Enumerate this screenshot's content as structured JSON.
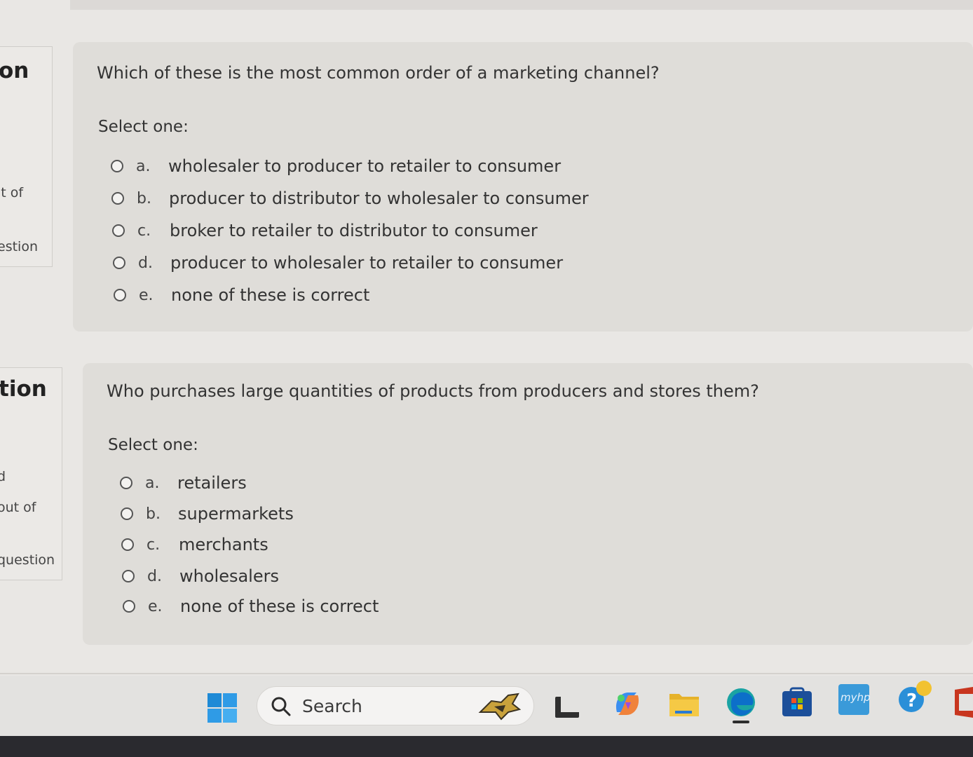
{
  "sidebar_cards": [
    {
      "heading": "on",
      "lines": [
        "it of",
        "estion"
      ]
    },
    {
      "heading": "tion",
      "lines": [
        "d",
        "out of",
        "question"
      ]
    }
  ],
  "questions": [
    {
      "text": "Which of these is the most common order of a marketing channel?",
      "select_label": "Select one:",
      "options": [
        {
          "letter": "a.",
          "text": "wholesaler to producer to retailer to consumer"
        },
        {
          "letter": "b.",
          "text": "producer to distributor to wholesaler to consumer"
        },
        {
          "letter": "c.",
          "text": "broker to retailer to distributor to consumer"
        },
        {
          "letter": "d.",
          "text": "producer to wholesaler to retailer to consumer"
        },
        {
          "letter": "e.",
          "text": "none of these is correct"
        }
      ]
    },
    {
      "text": "Who purchases large quantities of products from producers and stores them?",
      "select_label": "Select one:",
      "options": [
        {
          "letter": "a.",
          "text": "retailers"
        },
        {
          "letter": "b.",
          "text": "supermarkets"
        },
        {
          "letter": "c.",
          "text": "merchants"
        },
        {
          "letter": "d.",
          "text": "wholesalers"
        },
        {
          "letter": "e.",
          "text": "none of these is correct"
        }
      ]
    }
  ],
  "taskbar": {
    "search_label": "Search",
    "myhp_label": "myhp",
    "icons": [
      "start-icon",
      "search-icon",
      "search-highlight-icon",
      "widget-app-icon",
      "copilot-icon",
      "file-explorer-icon",
      "edge-icon",
      "microsoft-store-icon",
      "myhp-icon",
      "help-icon",
      "office-app-icon"
    ]
  },
  "colors": {
    "page_background": "#e9e7e4",
    "question_panel": "#dfddd9",
    "taskbar": "#e3e2e0"
  }
}
